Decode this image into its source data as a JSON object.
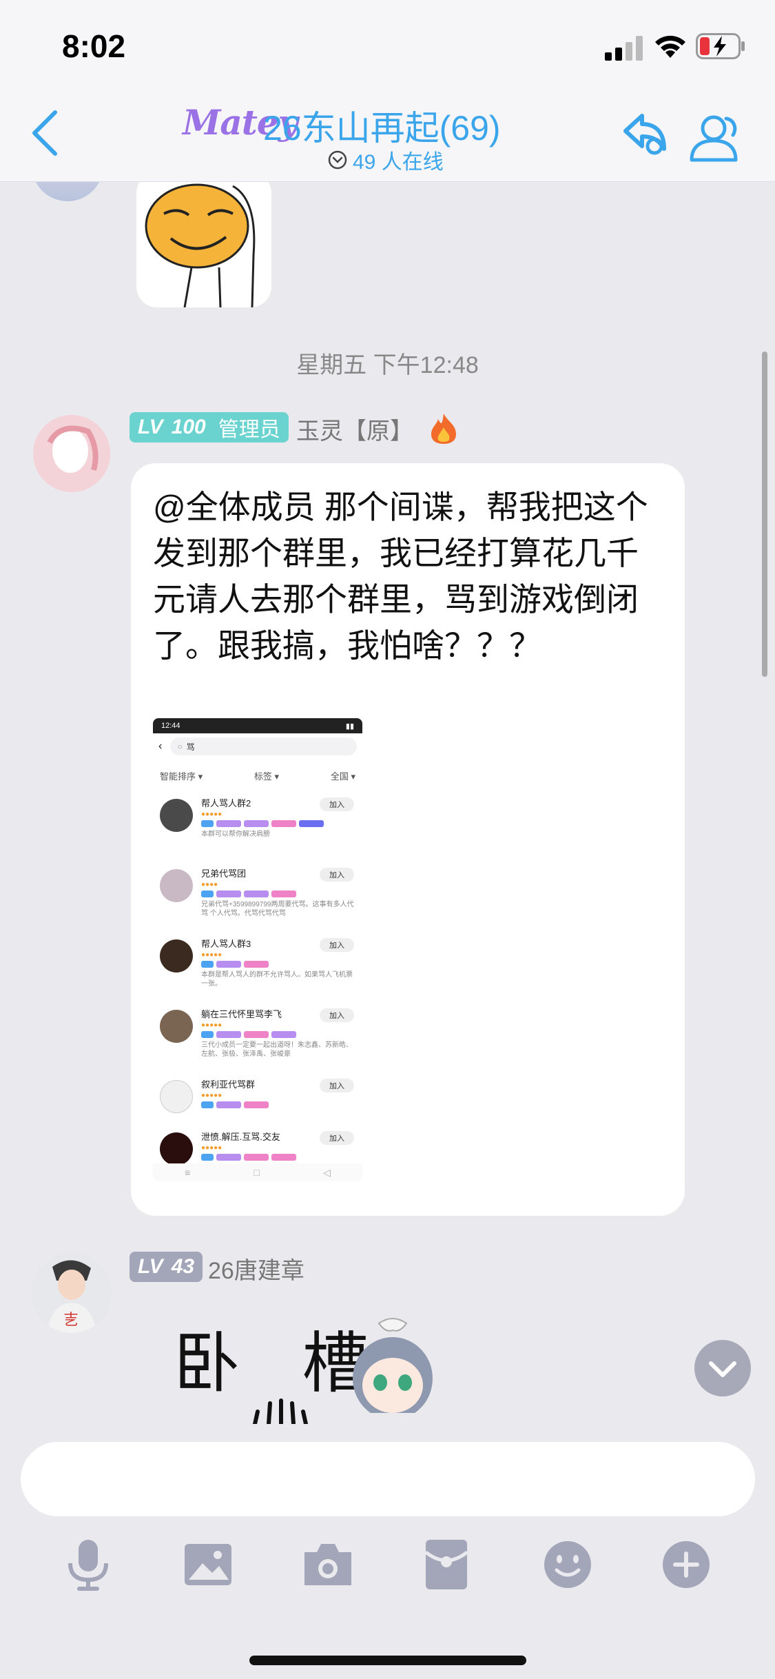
{
  "status_bar": {
    "time": "8:02"
  },
  "header": {
    "logo_text": "Matey",
    "title": "26东山再起(69)",
    "online": "49 人在线"
  },
  "messages": {
    "timestamp": "星期五 下午12:48",
    "msg1": {
      "level": "LV",
      "level_num": "100",
      "role": "管理员",
      "nickname": "玉灵【原】",
      "text": "@全体成员 那个间谍，帮我把这个发到那个群里，我已经打算花几千元请人去那个群里，骂到游戏倒闭了。跟我搞，我怕啥？？？",
      "screenshot": {
        "time": "12:44",
        "search": "骂",
        "filters": [
          "智能排序 ▾",
          "标签 ▾",
          "全国 ▾"
        ],
        "join_label": "加入",
        "groups": [
          {
            "name": "帮人骂人群2",
            "stars": "●●●●●",
            "desc": "本群可以帮你解决肩膀"
          },
          {
            "name": "兄弟代骂团",
            "stars": "●●●●",
            "desc": "兄弟代骂+3599899799两周要代骂。这事有多人代骂 个人代骂。代骂代骂代骂"
          },
          {
            "name": "帮人骂人群3",
            "stars": "●●●●●",
            "desc": "本群是帮人骂人的群不允许骂人。如果骂人飞机票一张。"
          },
          {
            "name": "躺在三代怀里骂李飞",
            "stars": "●●●●●",
            "desc": "三代小成员一定要一起出道呀！朱志鑫、苏新皓、左航、张极、张泽禹、张峻豪"
          },
          {
            "name": "叙利亚代骂群",
            "stars": "●●●●●",
            "desc": ""
          },
          {
            "name": "泄愤.解压.互骂.交友",
            "stars": "●●●●●",
            "desc": ""
          }
        ],
        "nav": [
          "≡",
          "□",
          "◁"
        ]
      }
    },
    "msg2": {
      "level": "LV",
      "level_num": "43",
      "nickname": "26唐建章",
      "sticker_text": "卧 槽"
    }
  },
  "colors": {
    "accent": "#3aa5ea",
    "badge_admin": "#6bd3cf",
    "badge_member": "#a3a5b8"
  }
}
